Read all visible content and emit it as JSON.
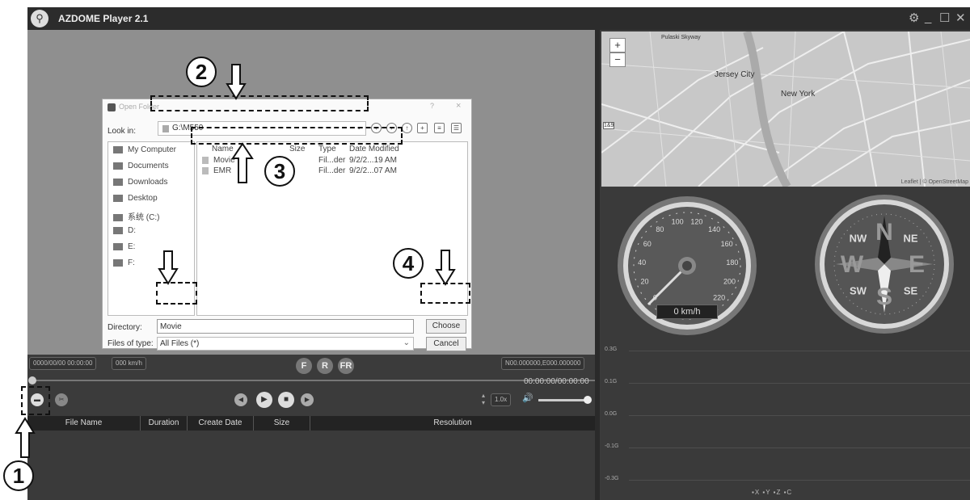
{
  "app": {
    "title": "AZDOME Player 2.1",
    "logo_icon": "pin-icon"
  },
  "window_controls": {
    "settings": "⚙",
    "minimize": "_",
    "maximize": "☐",
    "close": "✕"
  },
  "dialog": {
    "title": "Open Folder",
    "help": "?",
    "close": "×",
    "look_in_label": "Look in:",
    "look_in_value": "G:\\M550",
    "places": [
      {
        "label": "My Computer",
        "icon": "computer-icon"
      },
      {
        "label": "Documents",
        "icon": "documents-icon"
      },
      {
        "label": "Downloads",
        "icon": "downloads-icon"
      },
      {
        "label": "Desktop",
        "icon": "desktop-icon"
      },
      {
        "label": "系统 (C:)",
        "icon": "drive-icon"
      },
      {
        "label": "D:",
        "icon": "drive-icon"
      },
      {
        "label": "E:",
        "icon": "drive-icon"
      },
      {
        "label": "F:",
        "icon": "drive-icon"
      }
    ],
    "columns": [
      "Name",
      "Size",
      "Type",
      "Date Modified"
    ],
    "files": [
      {
        "name": "Movie",
        "size": "",
        "type": "Fil...der",
        "date": "9/2/2...19 AM"
      },
      {
        "name": "EMR",
        "size": "",
        "type": "Fil...der",
        "date": "9/2/2...07 AM"
      }
    ],
    "directory_label": "Directory:",
    "directory_value": "Movie",
    "choose_label": "Choose",
    "files_of_type_label": "Files of type:",
    "files_of_type_value": "All Files (*)",
    "cancel_label": "Cancel"
  },
  "annotations": {
    "step1": "1",
    "step2": "2",
    "step3": "3",
    "step4": "4"
  },
  "info": {
    "datetime": "0000/00/00 00:00:00",
    "speed": "000 km/h",
    "btn_f": "F",
    "btn_r": "R",
    "btn_fr": "FR",
    "coords": "N00.000000,E000.000000",
    "timecode": "00:00:00/00:00:00",
    "playback_rate": "1.0x"
  },
  "table": {
    "columns": [
      "File Name",
      "Duration",
      "Create Date",
      "Size",
      "Resolution"
    ]
  },
  "map": {
    "labels": [
      "Pulaski Skyway",
      "Jersey City",
      "New York"
    ],
    "route_badge": "1&9",
    "attribution": "Leaflet | © OpenStreetMap",
    "zoom_in": "+",
    "zoom_out": "−"
  },
  "speedometer": {
    "ticks": [
      "0",
      "20",
      "40",
      "60",
      "80",
      "100",
      "120",
      "140",
      "160",
      "180",
      "200",
      "220"
    ],
    "reading": "0 km/h"
  },
  "compass": {
    "letters": [
      "N",
      "NE",
      "E",
      "SE",
      "S",
      "SW",
      "W",
      "NW"
    ]
  },
  "accel_chart": {
    "y_labels": [
      "0.3G",
      "0.1G",
      "0.0G",
      "-0.1G",
      "-0.3G"
    ],
    "legend": "▪X ▪Y ▪Z ▪C"
  }
}
